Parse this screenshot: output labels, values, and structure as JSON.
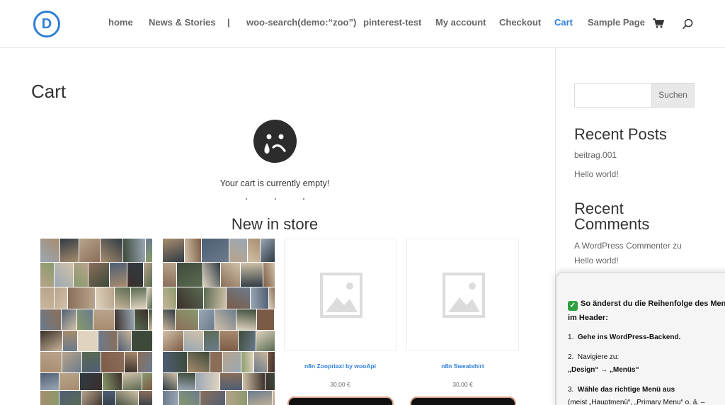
{
  "header": {
    "logo_letter": "D",
    "nav": [
      {
        "label": "home",
        "active": false
      },
      {
        "label": "News & Stories",
        "active": false
      },
      {
        "label": "|",
        "active": false
      },
      {
        "label": "woo-search(demo:“zoo”)",
        "active": false
      },
      {
        "label": "pinterest-test",
        "active": false
      },
      {
        "label": "My account",
        "active": false
      },
      {
        "label": "Checkout",
        "active": false
      },
      {
        "label": "Cart",
        "active": true
      },
      {
        "label": "Sample Page",
        "active": false
      }
    ],
    "cart_icon": "shopping-cart-icon",
    "search_icon": "search-icon",
    "accent_color": "#2e7ed8"
  },
  "main": {
    "title": "Cart",
    "empty_icon": "sad-face-icon",
    "empty_message": "Your cart is currently empty!",
    "new_in_store": "New in store",
    "products": [
      {
        "image": "photo-collage",
        "name": "",
        "price": ""
      },
      {
        "image": "photo-collage",
        "name": "",
        "price": ""
      },
      {
        "image": "placeholder-image-icon",
        "name": "n8n Zoopriaxi by wooApi",
        "price": "30,00 €"
      },
      {
        "image": "placeholder-image-icon",
        "name": "n8n Sweatshirt",
        "price": "30,00 €"
      }
    ]
  },
  "sidebar": {
    "search_placeholder": "",
    "search_button": "Suchen",
    "recent_posts_title": "Recent Posts",
    "recent_posts": [
      "beitrag.001",
      "Hello world!"
    ],
    "recent_comments_title_1": "Recent",
    "recent_comments_title_2": "Comments",
    "recent_comment_author": "A WordPress Commenter zu",
    "recent_comment_post": "Hello world!"
  },
  "popup": {
    "heading": "So änderst du die Reihenfolge des Menüs im Header:",
    "step1_num": "1.",
    "step1": "Gehe ins WordPress-Backend.",
    "step2_num": "2.",
    "step2": "Navigiere zu:",
    "step2_path": "„Design“ → „Menüs“",
    "step3_num": "3.",
    "step3": "Wähle das richtige Menü aus",
    "step3_detail": "(meist „Hauptmenü“, „Primary Menu“ o. ä. –"
  }
}
